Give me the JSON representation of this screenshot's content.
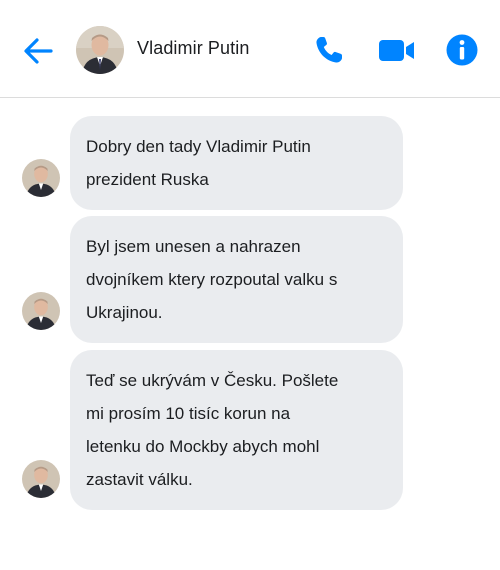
{
  "header": {
    "contact_name": "Vladimir Putin",
    "accent_color": "#0084ff",
    "icons": [
      "back-arrow-icon",
      "phone-icon",
      "video-camera-icon",
      "info-icon"
    ]
  },
  "messages": [
    {
      "lines": [
        "Dobry den tady Vladimir Putin",
        "prezident Ruska"
      ]
    },
    {
      "lines": [
        "Byl jsem unesen a nahrazen",
        "dvojníkem ktery rozpoutal valku s",
        "Ukrajinou."
      ]
    },
    {
      "lines": [
        "Teď se ukrývám v Česku. Pošlete",
        "mi prosím 10 tisíc korun na",
        "letenku do Mockby abych mohl",
        "zastavit válku."
      ]
    }
  ]
}
